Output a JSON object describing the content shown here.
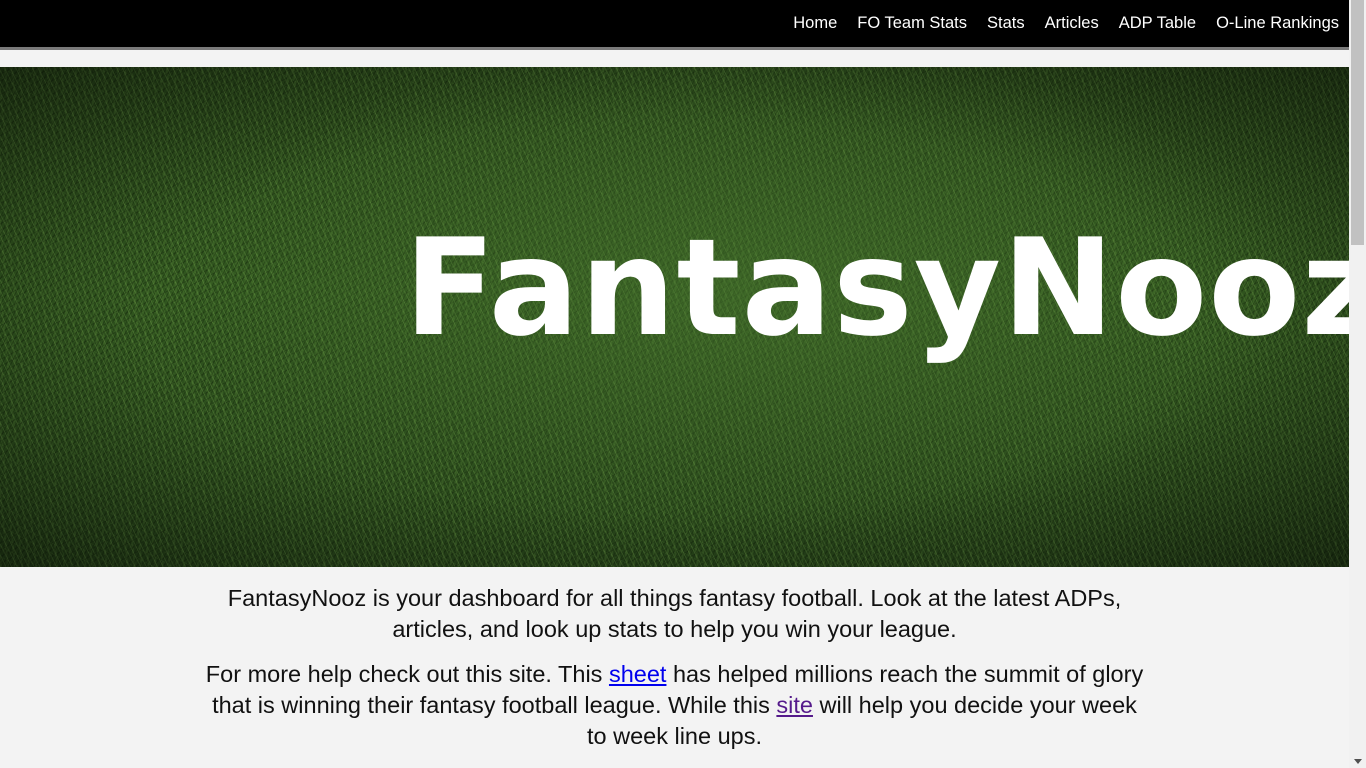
{
  "nav": {
    "items": [
      {
        "label": "Home"
      },
      {
        "label": "FO Team Stats"
      },
      {
        "label": "Stats"
      },
      {
        "label": "Articles"
      },
      {
        "label": "ADP Table"
      },
      {
        "label": "O-Line Rankings"
      }
    ]
  },
  "hero": {
    "title": "FantasyNooz",
    "background": "grass-field-image"
  },
  "intro": {
    "paragraph1": "FantasyNooz is your dashboard for all things fantasy football. Look at the latest ADPs, articles, and look up stats to help you win your league.",
    "paragraph2_before": "For more help check out this site. This ",
    "paragraph2_link1": "sheet",
    "paragraph2_middle": " has helped millions reach the summit of glory that is winning their fantasy football league. While this ",
    "paragraph2_link2": "site",
    "paragraph2_after": " will help you decide your week to week line ups."
  },
  "colors": {
    "navbar": "#000000",
    "link_unvisited": "#0000ee",
    "link_visited": "#551a8b",
    "page_background": "#f3f3f3"
  }
}
